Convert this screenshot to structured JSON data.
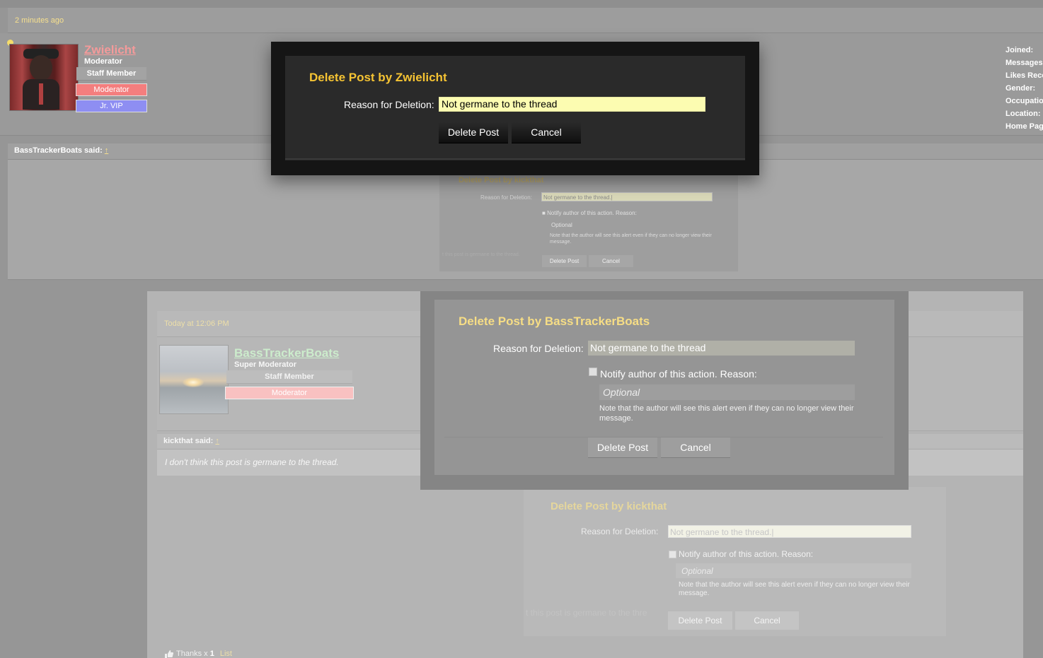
{
  "top_post": {
    "timestamp": "2 minutes ago",
    "username": "Zwielicht",
    "user_title": "Moderator",
    "staff_label": "Staff Member",
    "badges": [
      "Moderator",
      "Jr. VIP"
    ],
    "info_labels": [
      "Joined:",
      "Messages:",
      "Likes Rece",
      "Gender:",
      "Occupation",
      "Location:",
      "Home Pag"
    ],
    "quote_author": "BassTrackerBoats said:",
    "quote_arrow": "↑"
  },
  "ghost_popup_top": {
    "title": "Delete Post by kickthat",
    "reason_label": "Reason for Deletion:",
    "reason_value": "Not germane to the thread.|",
    "notify_label": "Notify author of this action. Reason:",
    "optional_placeholder": "Optional",
    "note": "Note that the author will see this alert even if they can no longer view their message.",
    "delete_label": "Delete Post",
    "cancel_label": "Cancel",
    "faint_text": "t this post is germane to the thread."
  },
  "second_post": {
    "timestamp": "Today at 12:06 PM",
    "username": "BassTrackerBoats",
    "user_title": "Super Moderator",
    "staff_label": "Staff Member",
    "badge": "Moderator",
    "quote_author": "kickthat said:",
    "quote_arrow": "↑",
    "quote_text": "I don't think this post is germane to the thread.",
    "thanks_prefix": "Thanks x",
    "thanks_count": "1",
    "thanks_list": "List"
  },
  "ghost_popup_bottom": {
    "title": "Delete Post by kickthat",
    "reason_label": "Reason for Deletion:",
    "reason_value": "Not germane to the thread.|",
    "notify_label": "Notify author of this action. Reason:",
    "optional_placeholder": "Optional",
    "note": "Note that the author will see this alert even if they can no longer view their message.",
    "delete_label": "Delete Post",
    "cancel_label": "Cancel",
    "faint_text": "t this post is germane to the thre"
  },
  "popup_basstrackerboats": {
    "title": "Delete Post by BassTrackerBoats",
    "reason_label": "Reason for Deletion:",
    "reason_value": "Not germane to the thread",
    "notify_label": "Notify author of this action. Reason:",
    "optional_placeholder": "Optional",
    "note": "Note that the author will see this alert even if they can no longer view their message.",
    "delete_label": "Delete Post",
    "cancel_label": "Cancel"
  },
  "popup_zwielicht": {
    "title": "Delete Post by Zwielicht",
    "reason_label": "Reason for Deletion:",
    "reason_value": "Not germane to the thread",
    "delete_label": "Delete Post",
    "cancel_label": "Cancel"
  },
  "colors": {
    "accent_gold": "#f5c333",
    "input_yellow": "#fcfcb1",
    "moderator_badge": "#f47e7e",
    "vip_badge": "#8e8ef2"
  }
}
